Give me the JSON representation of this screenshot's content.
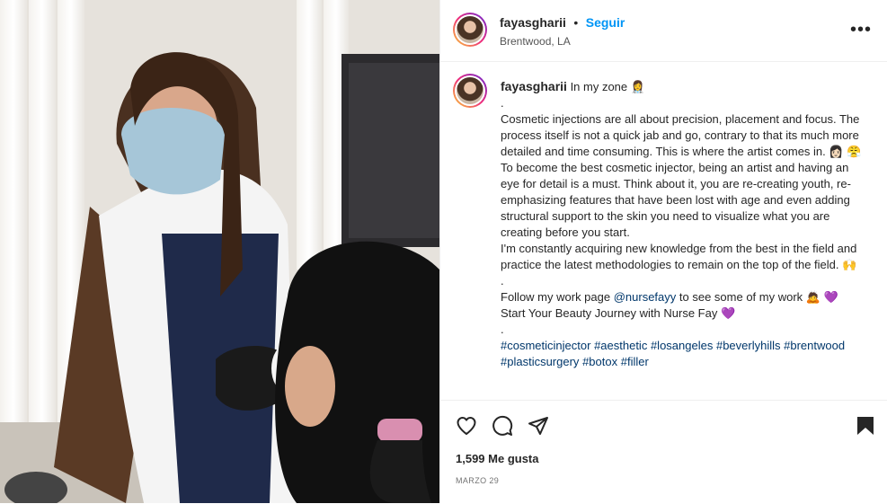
{
  "post": {
    "username": "fayasgharii",
    "separator": "•",
    "follow_label": "Seguir",
    "location": "Brentwood, LA",
    "more_label": "•••"
  },
  "caption": {
    "username": "fayasgharii",
    "first_line": "In my zone 👩‍⚕️",
    "dot1": ".",
    "p1": "Cosmetic injections are all about precision, placement and focus. The process itself is not a quick jab and go, contrary to that its much more detailed and time consuming. This is where the artist comes in. 👩🏻 😤",
    "p2": "To become the best cosmetic injector, being an artist and having an eye for detail is a must. Think about it, you are re-creating youth, re-emphasizing features that have been lost with age and even adding structural support to the skin you need to visualize what you are creating before you start.",
    "p3": "I'm constantly acquiring new knowledge from the best in the field and practice the latest methodologies to remain on the top of the field. 🙌",
    "dot2": ".",
    "follow_prefix": "Follow my work page ",
    "mention": "@nursefayy",
    "follow_suffix": " to see some of my work 🙇 💜",
    "journey": "Start Your Beauty Journey with Nurse Fay 💜",
    "dot3": ".",
    "hashtags": [
      "#cosmeticinjector",
      "#aesthetic",
      "#losangeles",
      "#beverlyhills",
      "#brentwood",
      "#plasticsurgery",
      "#botox",
      "#filler"
    ]
  },
  "stats": {
    "likes": "1,599 Me gusta",
    "date": "MARZO 29"
  },
  "icons": [
    "heart-icon",
    "comment-icon",
    "share-icon",
    "bookmark-icon"
  ],
  "colors": {
    "follow": "#0095f6",
    "link": "#00376b",
    "text": "#262626",
    "muted": "#737373"
  }
}
